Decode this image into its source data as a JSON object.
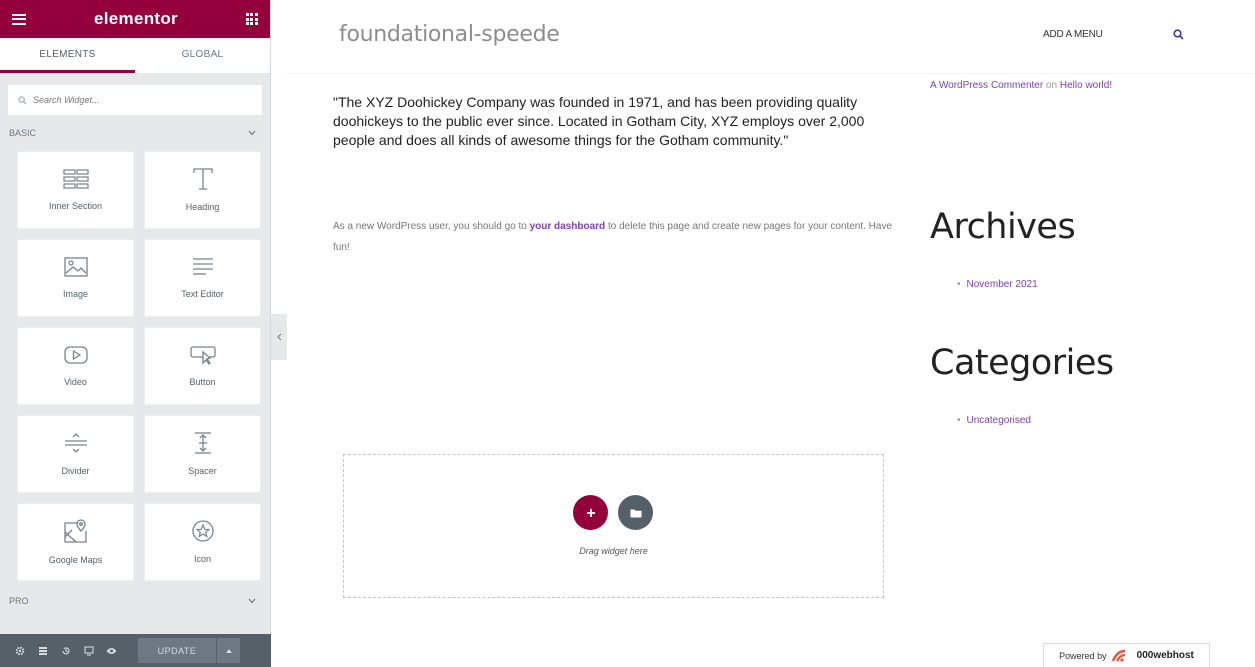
{
  "panel": {
    "logo": "elementor",
    "tabs": [
      {
        "label": "ELEMENTS"
      },
      {
        "label": "GLOBAL"
      }
    ],
    "search_placeholder": "Search Widget...",
    "categories": {
      "basic": "BASIC",
      "pro": "PRO"
    },
    "widgets": [
      {
        "label": "Inner Section",
        "icon": "inner-section-icon"
      },
      {
        "label": "Heading",
        "icon": "heading-icon"
      },
      {
        "label": "Image",
        "icon": "image-icon"
      },
      {
        "label": "Text Editor",
        "icon": "text-editor-icon"
      },
      {
        "label": "Video",
        "icon": "video-icon"
      },
      {
        "label": "Button",
        "icon": "button-icon"
      },
      {
        "label": "Divider",
        "icon": "divider-icon"
      },
      {
        "label": "Spacer",
        "icon": "spacer-icon"
      },
      {
        "label": "Google Maps",
        "icon": "google-maps-icon"
      },
      {
        "label": "Icon",
        "icon": "star-icon"
      }
    ],
    "footer": {
      "update_label": "UPDATE"
    }
  },
  "site": {
    "title": "foundational-speede",
    "menu_label": "ADD A MENU",
    "quote": "\"The XYZ Doohickey Company was founded in 1971, and has been providing quality doohickeys to the public ever since. Located in Gotham City, XYZ employs over 2,000 people and does all kinds of awesome things for the Gotham community.\"",
    "welcome_before": "As a new WordPress user, you should go to ",
    "welcome_link": "your dashboard",
    "welcome_after": " to delete this page and create new pages for your content. Have fun!",
    "sidebar": {
      "comment_author": "A WordPress Commenter",
      "comment_on": " on ",
      "comment_post": "Hello world!",
      "archives_title": "Archives",
      "archives": [
        "November 2021"
      ],
      "categories_title": "Categories",
      "categories": [
        "Uncategorised"
      ]
    },
    "drop_zone_label": "Drag widget here",
    "powered_by": "Powered by",
    "powered_brand": "000webhost"
  },
  "colors": {
    "brand": "#93003c",
    "link": "#7c3fb8",
    "panel_bg": "#e6e8ea",
    "footer_bg": "#556068"
  }
}
